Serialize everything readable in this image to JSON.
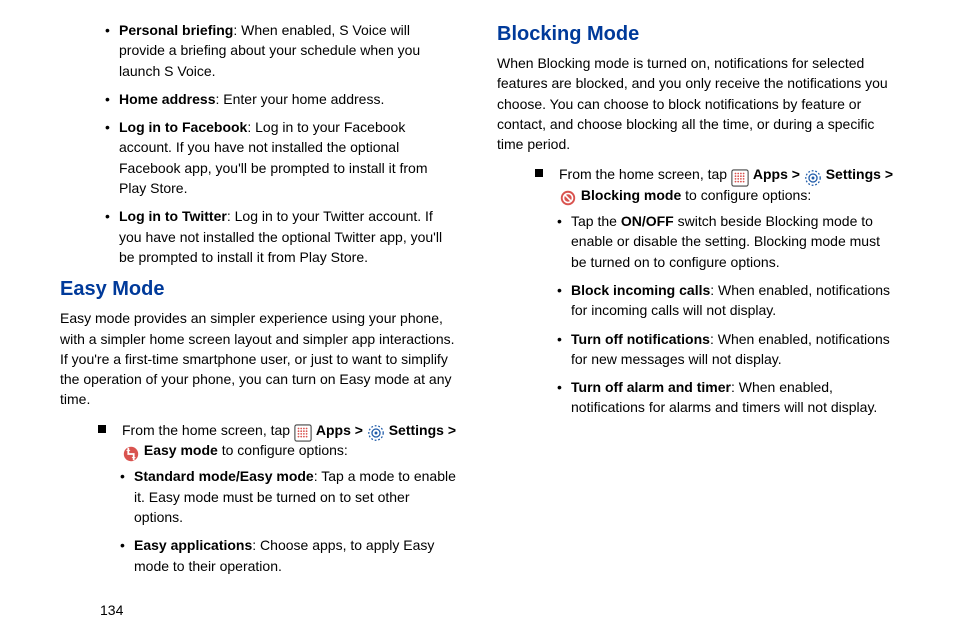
{
  "page_number": "134",
  "left": {
    "bullets_top": [
      {
        "bold": "Personal briefing",
        "rest": ": When enabled, S Voice will provide a briefing about your schedule when you launch S Voice."
      },
      {
        "bold": "Home address",
        "rest": ": Enter your home address."
      },
      {
        "bold": "Log in to Facebook",
        "rest": ": Log in to your Facebook account. If you have not installed the optional Facebook app, you'll be prompted to install it from Play Store."
      },
      {
        "bold": "Log in to Twitter",
        "rest": ": Log in to your Twitter account. If you have not installed the optional Twitter app, you'll be prompted to install it from Play Store."
      }
    ],
    "heading": "Easy Mode",
    "para": "Easy mode provides an simpler experience using your phone, with a simpler home screen layout and simpler app interactions. If you're a first-time smartphone user, or just to want to simplify the operation of your phone, you can turn on Easy mode at any time.",
    "instr_pre": "From the home screen, tap ",
    "instr_apps": " Apps > ",
    "instr_settings": " Settings > ",
    "instr_mode": " Easy mode",
    "instr_post": " to configure options:",
    "sub_bullets": [
      {
        "bold": "Standard mode/Easy mode",
        "rest": ": Tap a mode to enable it. Easy mode must be turned on to set other options."
      },
      {
        "bold": "Easy applications",
        "rest": ": Choose apps, to apply Easy mode to their operation."
      }
    ]
  },
  "right": {
    "heading": "Blocking Mode",
    "para": "When Blocking mode is turned on, notifications for selected features are blocked, and you only receive the notifications you choose. You can choose to block notifications by feature or contact, and choose blocking all the time, or during a specific time period.",
    "instr_pre": "From the home screen, tap ",
    "instr_apps": " Apps > ",
    "instr_settings": " Settings > ",
    "instr_mode": " Blocking mode",
    "instr_post": " to configure options:",
    "sub_bullets": [
      {
        "bold_pre": "Tap the ",
        "bold_mid": "ON/OFF",
        "rest": " switch beside Blocking mode to enable or disable the setting. Blocking mode must be turned on to configure options."
      },
      {
        "bold": "Block incoming calls",
        "rest": ": When enabled, notifications for incoming calls will not display."
      },
      {
        "bold": "Turn off notifications",
        "rest": ": When enabled, notifications for new messages will not display."
      },
      {
        "bold": "Turn off alarm and timer",
        "rest": ": When enabled, notifications for alarms and timers will not display."
      }
    ]
  }
}
